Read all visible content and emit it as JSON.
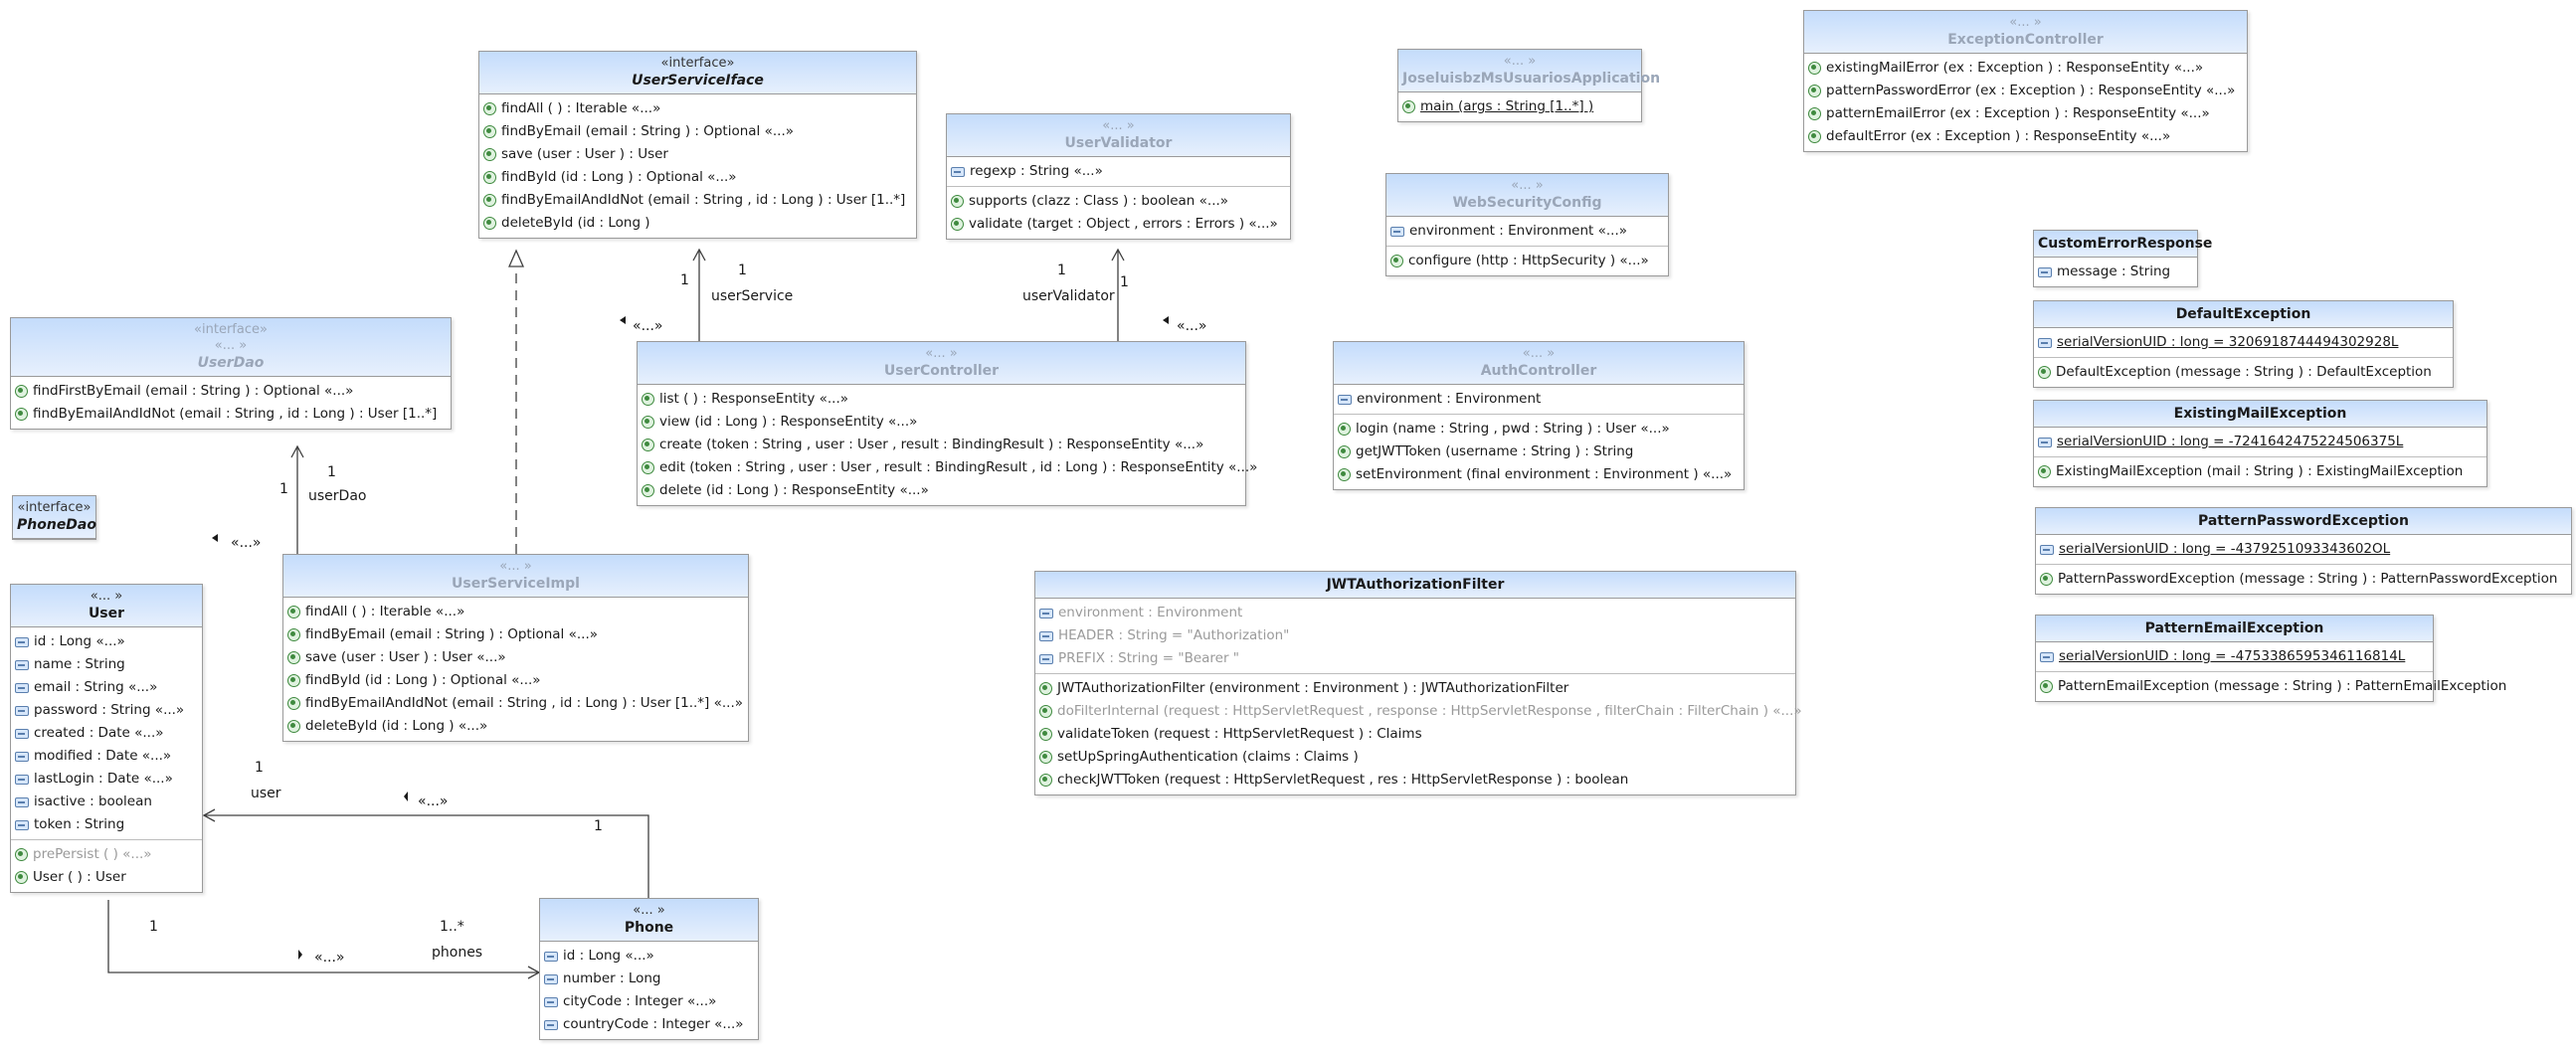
{
  "colors": {
    "header_top": "#c4dcfb",
    "header_bottom": "#e7f0fd",
    "border": "#9a9a9a",
    "line": "#404040"
  },
  "classes": {
    "userServiceIface": {
      "stereotype": "«interface»",
      "name": "UserServiceIface",
      "italic": true,
      "operations": [
        "findAll ( ) : Iterable «...»",
        "findByEmail (email : String ) : Optional «...»",
        "save (user : User ) : User",
        "findById (id : Long ) : Optional «...»",
        "findByEmailAndIdNot (email : String , id : Long ) : User [1..*]",
        "deleteById (id : Long )"
      ]
    },
    "userValidator": {
      "stereotype": "«... »",
      "name": "UserValidator",
      "fields": [
        "regexp : String «...»"
      ],
      "operations": [
        "supports (clazz : Class ) : boolean «...»",
        "validate (target : Object , errors : Errors ) «...»"
      ]
    },
    "application": {
      "stereotype": "«... »",
      "name": "JoseluisbzMsUsuariosApplication",
      "operations": [
        "main (args : String [1..*] )"
      ]
    },
    "exceptionController": {
      "stereotype": "«... »",
      "name": "ExceptionController",
      "operations": [
        "existingMailError (ex : Exception ) : ResponseEntity «...»",
        "patternPasswordError (ex : Exception ) : ResponseEntity «...»",
        "patternEmailError (ex : Exception ) : ResponseEntity «...»",
        "defaultError (ex : Exception ) : ResponseEntity «...»"
      ]
    },
    "webSecurityConfig": {
      "stereotype": "«... »",
      "name": "WebSecurityConfig",
      "fields": [
        "environment : Environment «...»"
      ],
      "operations": [
        "configure (http : HttpSecurity ) «...»"
      ]
    },
    "customErrorResponse": {
      "name": "CustomErrorResponse",
      "fields": [
        "message : String"
      ]
    },
    "defaultException": {
      "name": "DefaultException",
      "fields": [
        "serialVersionUID : long = 3206918744494302928L"
      ],
      "operations": [
        "DefaultException (message : String ) : DefaultException"
      ]
    },
    "existingMailException": {
      "name": "ExistingMailException",
      "fields": [
        "serialVersionUID : long = -7241642475224506375L"
      ],
      "operations": [
        "ExistingMailException (mail : String ) : ExistingMailException"
      ]
    },
    "patternPasswordException": {
      "name": "PatternPasswordException",
      "fields": [
        "serialVersionUID : long = -4379251093343602OL"
      ],
      "operations": [
        "PatternPasswordException (message : String ) : PatternPasswordException"
      ]
    },
    "patternEmailException": {
      "name": "PatternEmailException",
      "fields": [
        "serialVersionUID : long = -4753386595346116814L"
      ],
      "operations": [
        "PatternEmailException (message : String ) : PatternEmailException"
      ]
    },
    "userDao": {
      "stereotype": "«interface»",
      "stereotype2": "«... »",
      "name": "UserDao",
      "italic": true,
      "operations": [
        "findFirstByEmail (email : String ) : Optional «...»",
        "findByEmailAndIdNot (email : String , id : Long ) : User [1..*]"
      ]
    },
    "phoneDao": {
      "stereotype": "«interface»",
      "name": "PhoneDao",
      "italic": true
    },
    "userController": {
      "stereotype": "«... »",
      "name": "UserController",
      "operations": [
        "list ( ) : ResponseEntity «...»",
        "view (id : Long ) : ResponseEntity «...»",
        "create (token : String , user : User , result : BindingResult ) : ResponseEntity «...»",
        "edit (token : String , user : User , result : BindingResult , id : Long ) : ResponseEntity «...»",
        "delete (id : Long ) : ResponseEntity «...»"
      ]
    },
    "authController": {
      "stereotype": "«... »",
      "name": "AuthController",
      "fields": [
        "environment : Environment"
      ],
      "operations": [
        "login (name : String , pwd : String ) : User «...»",
        "getJWTToken (username : String ) : String",
        "setEnvironment (final environment : Environment ) «...»"
      ]
    },
    "user": {
      "stereotype": "«... »",
      "name": "User",
      "fields": [
        "id : Long «...»",
        "name : String",
        "email : String «...»",
        "password : String «...»",
        "created : Date «...»",
        "modified : Date «...»",
        "lastLogin : Date «...»",
        "isactive : boolean",
        "token : String"
      ],
      "operations": [
        "prePersist ( ) «...»",
        "User ( ) : User"
      ]
    },
    "userServiceImpl": {
      "stereotype": "«... »",
      "name": "UserServiceImpl",
      "operations": [
        "findAll ( ) : Iterable «...»",
        "findByEmail (email : String ) : Optional «...»",
        "save (user : User ) : User «...»",
        "findById (id : Long ) : Optional «...»",
        "findByEmailAndIdNot (email : String , id : Long ) : User [1..*] «...»",
        "deleteById (id : Long ) «...»"
      ]
    },
    "jwtFilter": {
      "name": "JWTAuthorizationFilter",
      "fields": [
        "environment : Environment",
        "HEADER : String = \"Authorization\"",
        "PREFIX : String = \"Bearer \""
      ],
      "operations": [
        "JWTAuthorizationFilter (environment : Environment ) : JWTAuthorizationFilter",
        "doFilterInternal (request : HttpServletRequest , response : HttpServletResponse , filterChain : FilterChain ) «...»",
        "validateToken (request : HttpServletRequest ) : Claims",
        "setUpSpringAuthentication (claims : Claims )",
        "checkJWTToken (request : HttpServletRequest , res : HttpServletResponse ) : boolean"
      ]
    },
    "phone": {
      "stereotype": "«... »",
      "name": "Phone",
      "fields": [
        "id : Long «...»",
        "number : Long",
        "cityCode : Integer «...»",
        "countryCode : Integer «...»"
      ]
    }
  },
  "associations": {
    "userService": {
      "role": "userService",
      "mult": "1",
      "mult_source": "1",
      "stereo": "«...»"
    },
    "userValidator": {
      "role": "userValidator",
      "mult": "1",
      "mult_source": "1",
      "stereo": "«...»"
    },
    "userDao": {
      "role": "userDao",
      "mult": "1",
      "stereo": "«...»"
    },
    "user": {
      "role": "user",
      "mult": "1",
      "mult_source": "1",
      "stereo": "«...»"
    },
    "phones": {
      "role": "phones",
      "mult": "1..*",
      "mult_source": "1",
      "stereo": "«...»"
    }
  }
}
